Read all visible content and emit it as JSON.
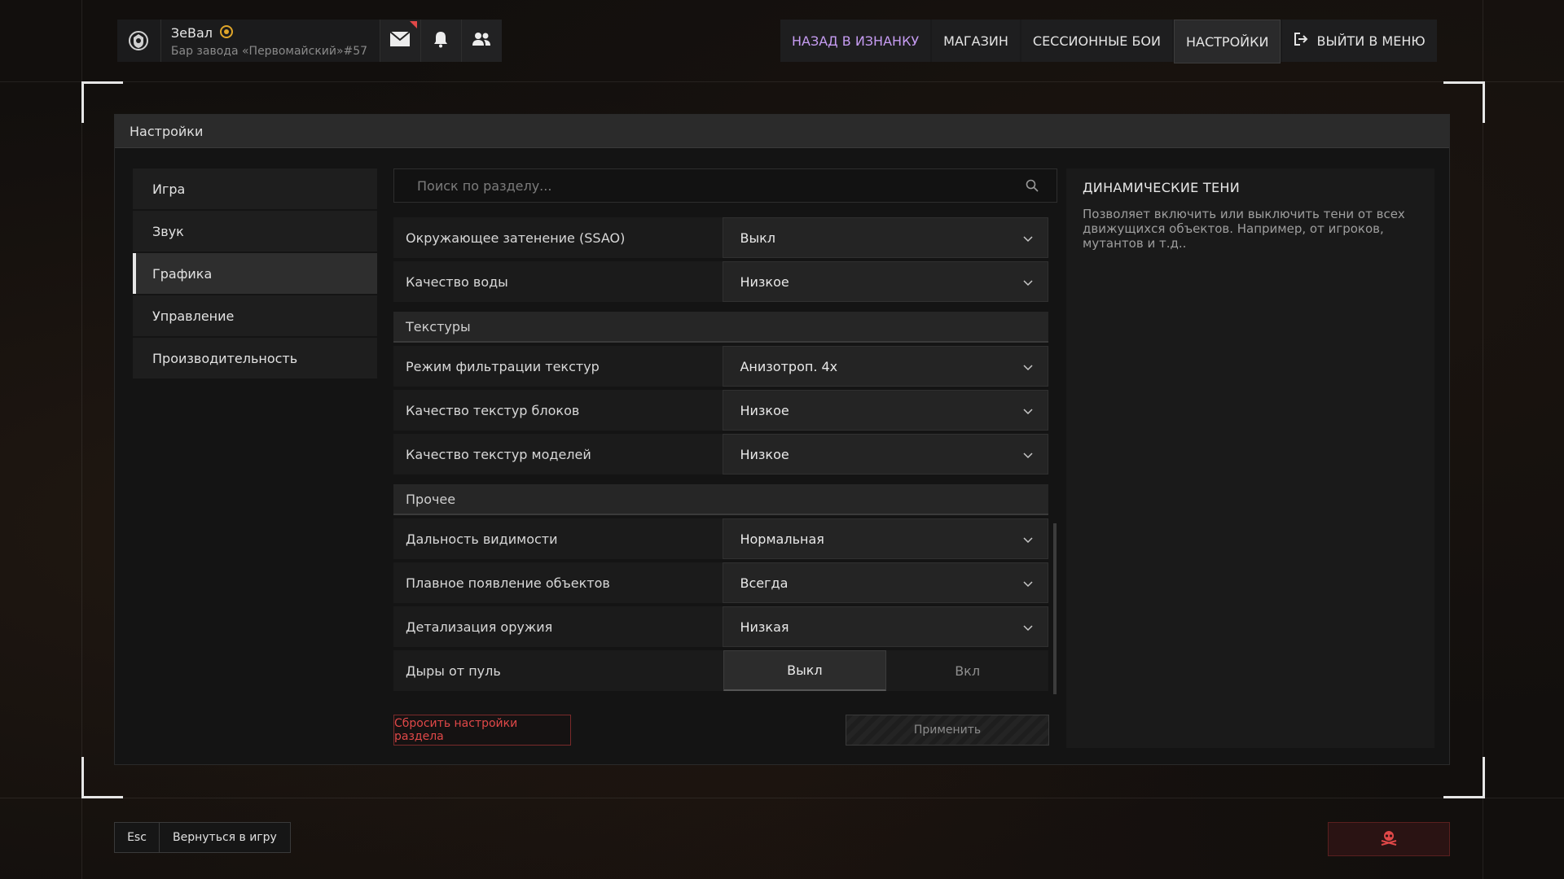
{
  "profile": {
    "name": "ЗеВал",
    "subtitle": "Бар завода «Первомайский»#57",
    "icons": [
      "shield-logo-icon",
      "mail-icon",
      "bell-icon",
      "friends-icon"
    ]
  },
  "topnav": {
    "items": [
      {
        "label": "НАЗАД В ИЗНАНКУ",
        "accent": true
      },
      {
        "label": "МАГАЗИН"
      },
      {
        "label": "СЕССИОННЫЕ БОИ"
      },
      {
        "label": "НАСТРОЙКИ",
        "active": true
      },
      {
        "label": "ВЫЙТИ В МЕНЮ",
        "icon": "logout-icon"
      }
    ]
  },
  "panel": {
    "title": "Настройки",
    "sidebar": [
      "Игра",
      "Звук",
      "Графика",
      "Управление",
      "Производительность"
    ],
    "active_sidebar": "Графика",
    "search_placeholder": "Поиск по разделу...",
    "rows_top": [
      {
        "label": "Окружающее затенение (SSAO)",
        "value": "Выкл"
      },
      {
        "label": "Качество воды",
        "value": "Низкое"
      }
    ],
    "section_textures": "Текстуры",
    "rows_textures": [
      {
        "label": "Режим фильтрации текстур",
        "value": "Анизотроп. 4x"
      },
      {
        "label": "Качество текстур блоков",
        "value": "Низкое"
      },
      {
        "label": "Качество текстур моделей",
        "value": "Низкое"
      }
    ],
    "section_other": "Прочее",
    "rows_other": [
      {
        "label": "Дальность видимости",
        "value": "Нормальная"
      },
      {
        "label": "Плавное появление объектов",
        "value": "Всегда"
      },
      {
        "label": "Детализация оружия",
        "value": "Низкая"
      }
    ],
    "toggle_row": {
      "label": "Дыры от пуль",
      "option_off": "Выкл",
      "option_on": "Вкл",
      "selected": "Выкл"
    },
    "reset_label": "Сбросить настройки раздела",
    "apply_label": "Применить",
    "info": {
      "title": "ДИНАМИЧЕСКИЕ ТЕНИ",
      "text": "Позволяет включить или выключить тени от всех движущихся объектов. Например, от игроков, мутантов и т.д.."
    }
  },
  "bottom": {
    "esc_key": "Esc",
    "esc_label": "Вернуться в игру"
  },
  "colors": {
    "accent": "#c69cf2",
    "danger": "#e04848"
  }
}
